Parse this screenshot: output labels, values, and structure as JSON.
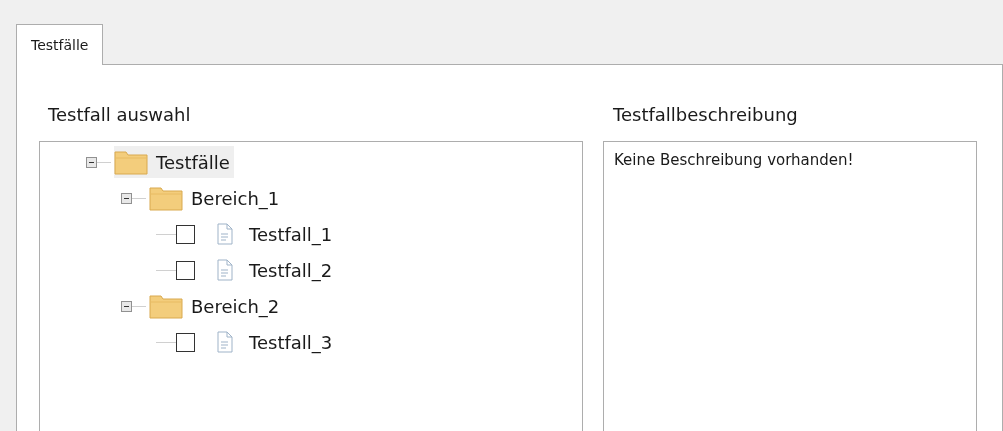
{
  "tabs": [
    {
      "label": "Testfälle",
      "selected": true
    }
  ],
  "tree_panel": {
    "label": "Testfall auswahl",
    "tree": [
      {
        "kind": "folder",
        "label": "Testfälle",
        "expanded": true,
        "selected": true,
        "children": [
          {
            "kind": "folder",
            "label": "Bereich_1",
            "expanded": true,
            "selected": false,
            "children": [
              {
                "kind": "testcase",
                "label": "Testfall_1",
                "checked": false,
                "selected": false
              },
              {
                "kind": "testcase",
                "label": "Testfall_2",
                "checked": false,
                "selected": false
              }
            ]
          },
          {
            "kind": "folder",
            "label": "Bereich_2",
            "expanded": true,
            "selected": false,
            "children": [
              {
                "kind": "testcase",
                "label": "Testfall_3",
                "checked": false,
                "selected": false
              }
            ]
          }
        ]
      }
    ]
  },
  "description_panel": {
    "label": "Testfallbeschreibung",
    "text": "Keine Beschreibung vorhanden!"
  }
}
